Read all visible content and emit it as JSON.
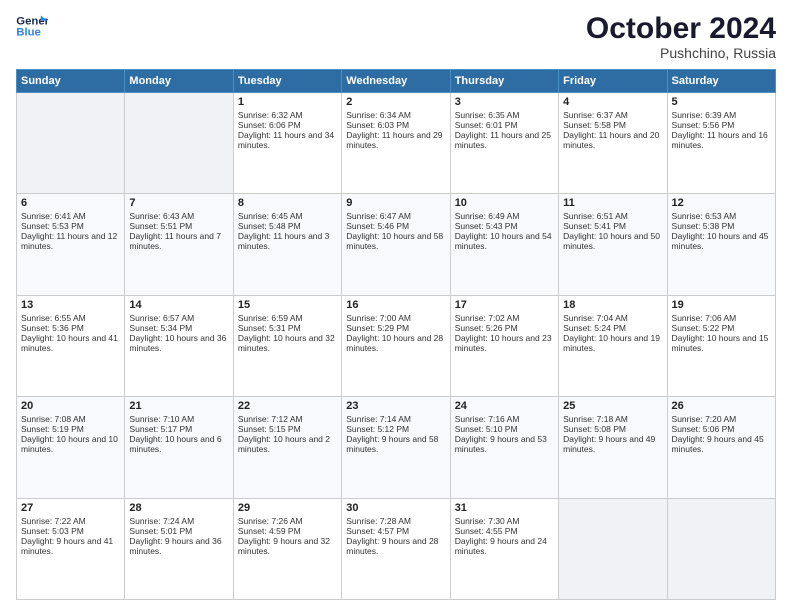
{
  "header": {
    "logo_line1": "General",
    "logo_line2": "Blue",
    "month": "October 2024",
    "location": "Pushchino, Russia"
  },
  "days_of_week": [
    "Sunday",
    "Monday",
    "Tuesday",
    "Wednesday",
    "Thursday",
    "Friday",
    "Saturday"
  ],
  "weeks": [
    [
      {
        "day": "",
        "sunrise": "",
        "sunset": "",
        "daylight": ""
      },
      {
        "day": "",
        "sunrise": "",
        "sunset": "",
        "daylight": ""
      },
      {
        "day": "1",
        "sunrise": "Sunrise: 6:32 AM",
        "sunset": "Sunset: 6:06 PM",
        "daylight": "Daylight: 11 hours and 34 minutes."
      },
      {
        "day": "2",
        "sunrise": "Sunrise: 6:34 AM",
        "sunset": "Sunset: 6:03 PM",
        "daylight": "Daylight: 11 hours and 29 minutes."
      },
      {
        "day": "3",
        "sunrise": "Sunrise: 6:35 AM",
        "sunset": "Sunset: 6:01 PM",
        "daylight": "Daylight: 11 hours and 25 minutes."
      },
      {
        "day": "4",
        "sunrise": "Sunrise: 6:37 AM",
        "sunset": "Sunset: 5:58 PM",
        "daylight": "Daylight: 11 hours and 20 minutes."
      },
      {
        "day": "5",
        "sunrise": "Sunrise: 6:39 AM",
        "sunset": "Sunset: 5:56 PM",
        "daylight": "Daylight: 11 hours and 16 minutes."
      }
    ],
    [
      {
        "day": "6",
        "sunrise": "Sunrise: 6:41 AM",
        "sunset": "Sunset: 5:53 PM",
        "daylight": "Daylight: 11 hours and 12 minutes."
      },
      {
        "day": "7",
        "sunrise": "Sunrise: 6:43 AM",
        "sunset": "Sunset: 5:51 PM",
        "daylight": "Daylight: 11 hours and 7 minutes."
      },
      {
        "day": "8",
        "sunrise": "Sunrise: 6:45 AM",
        "sunset": "Sunset: 5:48 PM",
        "daylight": "Daylight: 11 hours and 3 minutes."
      },
      {
        "day": "9",
        "sunrise": "Sunrise: 6:47 AM",
        "sunset": "Sunset: 5:46 PM",
        "daylight": "Daylight: 10 hours and 58 minutes."
      },
      {
        "day": "10",
        "sunrise": "Sunrise: 6:49 AM",
        "sunset": "Sunset: 5:43 PM",
        "daylight": "Daylight: 10 hours and 54 minutes."
      },
      {
        "day": "11",
        "sunrise": "Sunrise: 6:51 AM",
        "sunset": "Sunset: 5:41 PM",
        "daylight": "Daylight: 10 hours and 50 minutes."
      },
      {
        "day": "12",
        "sunrise": "Sunrise: 6:53 AM",
        "sunset": "Sunset: 5:38 PM",
        "daylight": "Daylight: 10 hours and 45 minutes."
      }
    ],
    [
      {
        "day": "13",
        "sunrise": "Sunrise: 6:55 AM",
        "sunset": "Sunset: 5:36 PM",
        "daylight": "Daylight: 10 hours and 41 minutes."
      },
      {
        "day": "14",
        "sunrise": "Sunrise: 6:57 AM",
        "sunset": "Sunset: 5:34 PM",
        "daylight": "Daylight: 10 hours and 36 minutes."
      },
      {
        "day": "15",
        "sunrise": "Sunrise: 6:59 AM",
        "sunset": "Sunset: 5:31 PM",
        "daylight": "Daylight: 10 hours and 32 minutes."
      },
      {
        "day": "16",
        "sunrise": "Sunrise: 7:00 AM",
        "sunset": "Sunset: 5:29 PM",
        "daylight": "Daylight: 10 hours and 28 minutes."
      },
      {
        "day": "17",
        "sunrise": "Sunrise: 7:02 AM",
        "sunset": "Sunset: 5:26 PM",
        "daylight": "Daylight: 10 hours and 23 minutes."
      },
      {
        "day": "18",
        "sunrise": "Sunrise: 7:04 AM",
        "sunset": "Sunset: 5:24 PM",
        "daylight": "Daylight: 10 hours and 19 minutes."
      },
      {
        "day": "19",
        "sunrise": "Sunrise: 7:06 AM",
        "sunset": "Sunset: 5:22 PM",
        "daylight": "Daylight: 10 hours and 15 minutes."
      }
    ],
    [
      {
        "day": "20",
        "sunrise": "Sunrise: 7:08 AM",
        "sunset": "Sunset: 5:19 PM",
        "daylight": "Daylight: 10 hours and 10 minutes."
      },
      {
        "day": "21",
        "sunrise": "Sunrise: 7:10 AM",
        "sunset": "Sunset: 5:17 PM",
        "daylight": "Daylight: 10 hours and 6 minutes."
      },
      {
        "day": "22",
        "sunrise": "Sunrise: 7:12 AM",
        "sunset": "Sunset: 5:15 PM",
        "daylight": "Daylight: 10 hours and 2 minutes."
      },
      {
        "day": "23",
        "sunrise": "Sunrise: 7:14 AM",
        "sunset": "Sunset: 5:12 PM",
        "daylight": "Daylight: 9 hours and 58 minutes."
      },
      {
        "day": "24",
        "sunrise": "Sunrise: 7:16 AM",
        "sunset": "Sunset: 5:10 PM",
        "daylight": "Daylight: 9 hours and 53 minutes."
      },
      {
        "day": "25",
        "sunrise": "Sunrise: 7:18 AM",
        "sunset": "Sunset: 5:08 PM",
        "daylight": "Daylight: 9 hours and 49 minutes."
      },
      {
        "day": "26",
        "sunrise": "Sunrise: 7:20 AM",
        "sunset": "Sunset: 5:06 PM",
        "daylight": "Daylight: 9 hours and 45 minutes."
      }
    ],
    [
      {
        "day": "27",
        "sunrise": "Sunrise: 7:22 AM",
        "sunset": "Sunset: 5:03 PM",
        "daylight": "Daylight: 9 hours and 41 minutes."
      },
      {
        "day": "28",
        "sunrise": "Sunrise: 7:24 AM",
        "sunset": "Sunset: 5:01 PM",
        "daylight": "Daylight: 9 hours and 36 minutes."
      },
      {
        "day": "29",
        "sunrise": "Sunrise: 7:26 AM",
        "sunset": "Sunset: 4:59 PM",
        "daylight": "Daylight: 9 hours and 32 minutes."
      },
      {
        "day": "30",
        "sunrise": "Sunrise: 7:28 AM",
        "sunset": "Sunset: 4:57 PM",
        "daylight": "Daylight: 9 hours and 28 minutes."
      },
      {
        "day": "31",
        "sunrise": "Sunrise: 7:30 AM",
        "sunset": "Sunset: 4:55 PM",
        "daylight": "Daylight: 9 hours and 24 minutes."
      },
      {
        "day": "",
        "sunrise": "",
        "sunset": "",
        "daylight": ""
      },
      {
        "day": "",
        "sunrise": "",
        "sunset": "",
        "daylight": ""
      }
    ]
  ]
}
